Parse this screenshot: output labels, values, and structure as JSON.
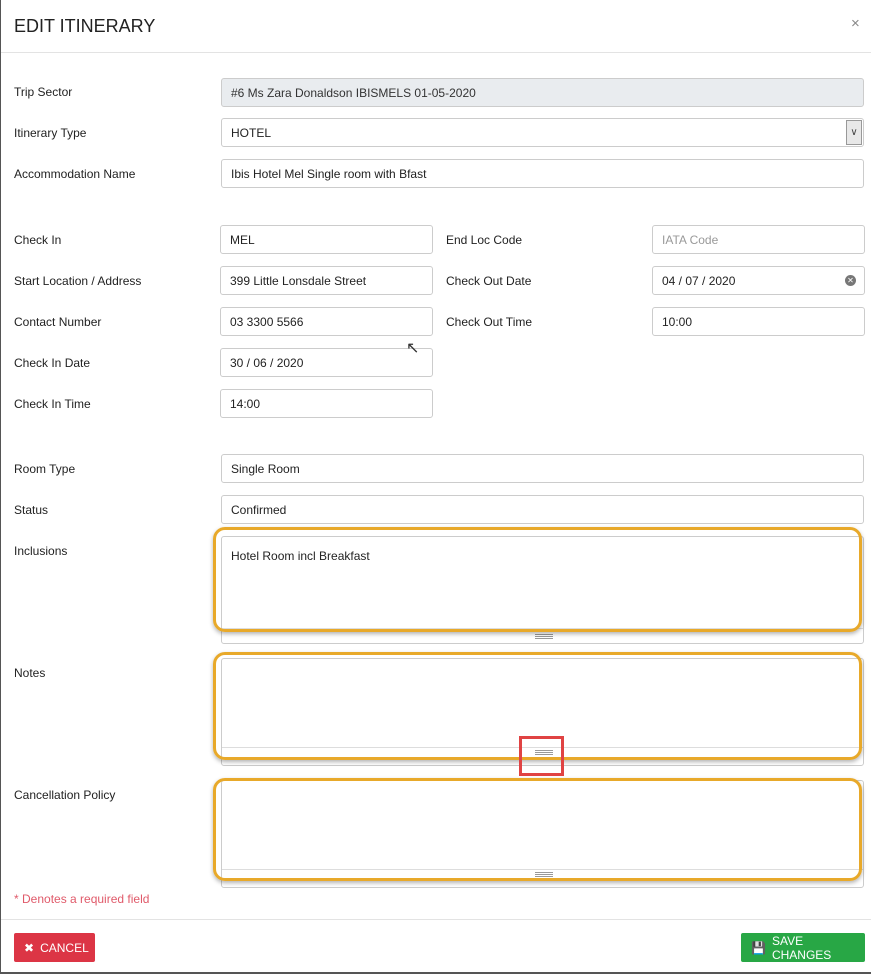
{
  "header": {
    "title": "EDIT ITINERARY",
    "close": "×"
  },
  "fields": {
    "trip_sector": {
      "label": "Trip Sector",
      "value": "#6 Ms Zara Donaldson IBISMELS 01-05-2020"
    },
    "itinerary_type": {
      "label": "Itinerary Type",
      "value": "HOTEL"
    },
    "accommodation_name": {
      "label": "Accommodation Name",
      "value": "Ibis Hotel Mel Single room with Bfast"
    },
    "check_in": {
      "label": "Check In",
      "value": "MEL"
    },
    "end_loc_code": {
      "label": "End Loc Code",
      "placeholder": "IATA Code"
    },
    "start_location": {
      "label": "Start Location / Address",
      "value": "399 Little Lonsdale Street"
    },
    "check_out_date": {
      "label": "Check Out Date",
      "value": "04 / 07 / 2020"
    },
    "contact_number": {
      "label": "Contact Number",
      "value": "03 3300 5566"
    },
    "check_out_time": {
      "label": "Check Out Time",
      "value": "10:00"
    },
    "check_in_date": {
      "label": "Check In Date",
      "value": "30 / 06 / 2020"
    },
    "check_in_time": {
      "label": "Check In Time",
      "value": "14:00"
    },
    "room_type": {
      "label": "Room Type",
      "value": "Single Room"
    },
    "status": {
      "label": "Status",
      "value": "Confirmed"
    },
    "inclusions": {
      "label": "Inclusions",
      "value": "Hotel Room incl Breakfast"
    },
    "notes": {
      "label": "Notes",
      "value": ""
    },
    "cancellation_policy": {
      "label": "Cancellation Policy",
      "value": ""
    }
  },
  "required_note": "* Denotes a required field",
  "footer": {
    "cancel": "CANCEL",
    "save": "SAVE CHANGES"
  },
  "colors": {
    "cancel": "#dc3545",
    "save": "#28a745",
    "highlight": "#e8a92a",
    "required": "#e05a6a"
  }
}
